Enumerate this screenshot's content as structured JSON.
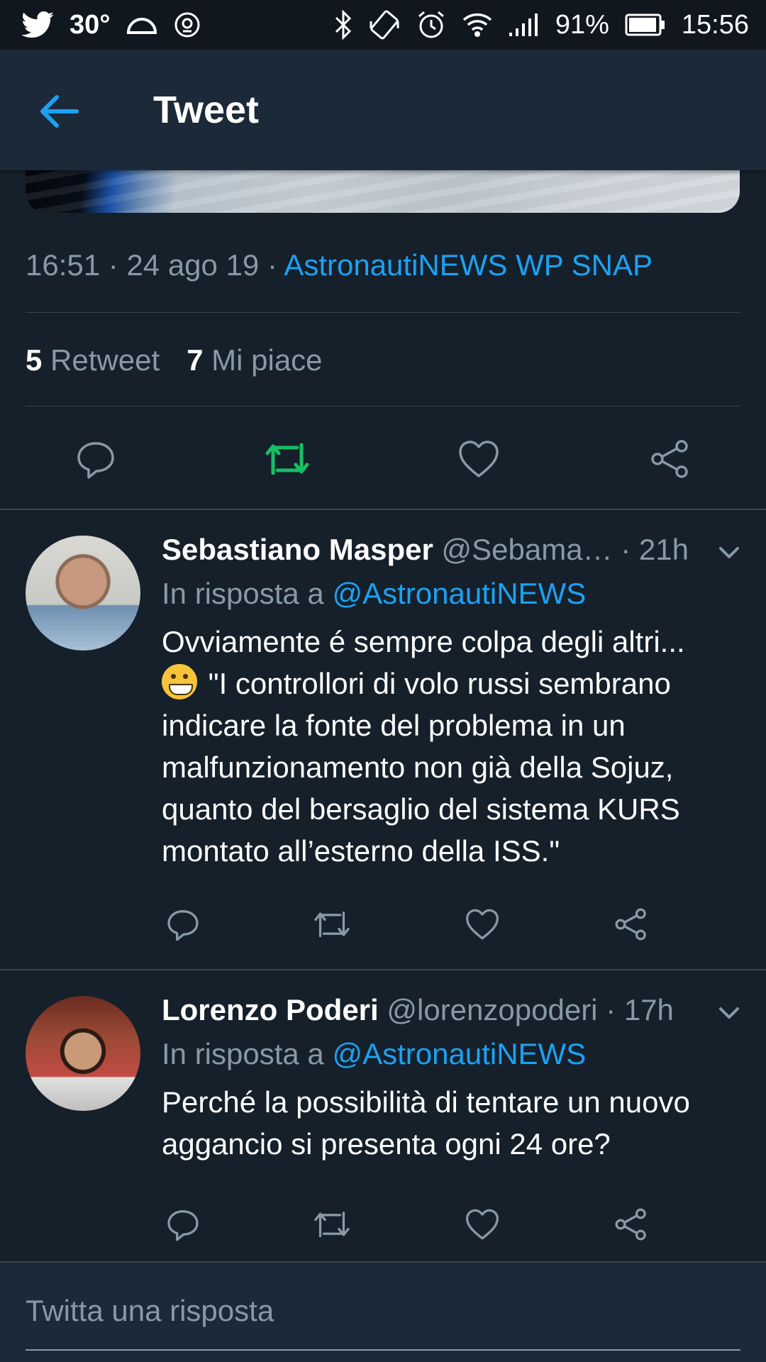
{
  "status_bar": {
    "temperature": "30°",
    "battery_percent": "91%",
    "time": "15:56",
    "icons": [
      "twitter-icon",
      "cloud-icon",
      "location-icon",
      "bluetooth-icon",
      "rotate-icon",
      "alarm-icon",
      "wifi-icon",
      "signal-icon",
      "battery-icon"
    ]
  },
  "header": {
    "title": "Tweet"
  },
  "tweet": {
    "time": "16:51",
    "date": "24 ago 19",
    "source": "AstronautiNEWS WP SNAP",
    "retweet_count": "5",
    "retweet_label": "Retweet",
    "like_count": "7",
    "like_label": "Mi piace",
    "retweeted": true,
    "colors": {
      "accent": "#1da1f2",
      "retweet_active": "#17bf63",
      "background": "#15202b",
      "muted": "#8899a6"
    }
  },
  "replies": [
    {
      "name": "Sebastiano Masper",
      "handle": "@Sebama…",
      "time": "21h",
      "reply_prefix": "In risposta a",
      "reply_to": "@AstronautiNEWS",
      "line1": "Ovviamente é sempre colpa degli altri...",
      "line2": "\"I controllori di volo russi sembrano indicare la fonte del problema in un malfunzionamento non già della Sojuz, quanto del bersaglio del sistema KURS montato all’esterno della ISS.\""
    },
    {
      "name": "Lorenzo Poderi",
      "handle": "@lorenzopoderi",
      "time": "17h",
      "reply_prefix": "In risposta a",
      "reply_to": "@AstronautiNEWS",
      "text": "Perché la possibilità di tentare un nuovo aggancio si presenta ogni 24 ore?"
    }
  ],
  "composer": {
    "placeholder": "Twitta una risposta"
  }
}
